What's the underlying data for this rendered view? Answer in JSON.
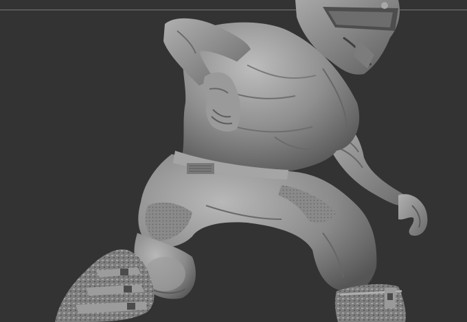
{
  "viewport": {
    "background_color": "#333333",
    "guide_line_color": "#7a7a7a"
  },
  "sculpt": {
    "material_color": "#8e8e8e",
    "highlight_color": "#c4c4c4",
    "shadow_color": "#4a4a4a",
    "subject": "motocross-rider-sculpt"
  }
}
